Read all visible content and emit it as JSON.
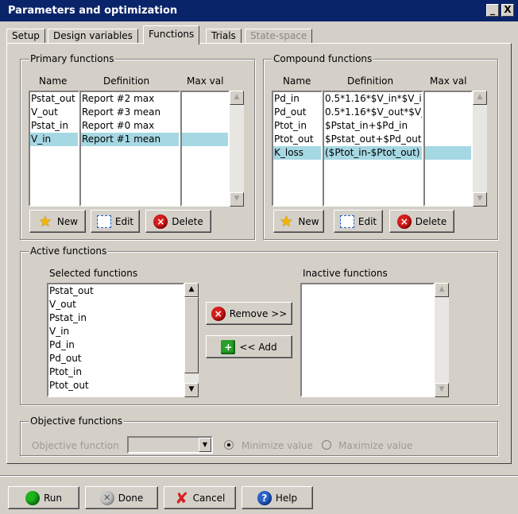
{
  "window": {
    "title": "Parameters and optimization",
    "minimize_glyph": "_",
    "close_glyph": "X"
  },
  "tabs": [
    {
      "label": "Setup",
      "state": "normal"
    },
    {
      "label": "Design variables",
      "state": "normal"
    },
    {
      "label": "Functions",
      "state": "active"
    },
    {
      "label": "Trials",
      "state": "normal"
    },
    {
      "label": "State-space",
      "state": "disabled"
    }
  ],
  "primary": {
    "title": "Primary functions",
    "headers": {
      "name": "Name",
      "definition": "Definition",
      "max": "Max val"
    },
    "names": [
      "Pstat_out",
      "V_out",
      "Pstat_in",
      "V_in"
    ],
    "definitions": [
      "Report #2 max",
      "Report #3 mean",
      "Report #0 max",
      "Report #1 mean"
    ],
    "maxvals": [
      "",
      "",
      "",
      ""
    ],
    "selected_row": 3,
    "buttons": {
      "new": "New",
      "edit": "Edit",
      "delete": "Delete"
    }
  },
  "compound": {
    "title": "Compound functions",
    "headers": {
      "name": "Name",
      "definition": "Definition",
      "max": "Max val"
    },
    "names": [
      "Pd_in",
      "Pd_out",
      "Ptot_in",
      "Ptot_out",
      "K_loss"
    ],
    "definitions": [
      "0.5*1.16*$V_in*$V_i",
      "0.5*1.16*$V_out*$V_",
      "$Pstat_in+$Pd_in",
      "$Pstat_out+$Pd_out",
      "($Ptot_in-$Ptot_out)"
    ],
    "maxvals": [
      "",
      "",
      "",
      "",
      ""
    ],
    "selected_row": 4,
    "buttons": {
      "new": "New",
      "edit": "Edit",
      "delete": "Delete"
    }
  },
  "active": {
    "title": "Active functions",
    "selected_label": "Selected functions",
    "inactive_label": "Inactive functions",
    "selected_items": [
      "Pstat_out",
      "V_out",
      "Pstat_in",
      "V_in",
      "Pd_in",
      "Pd_out",
      "Ptot_in",
      "Ptot_out"
    ],
    "inactive_items": [],
    "remove_label": "Remove >>",
    "add_label": "<< Add"
  },
  "objective": {
    "title": "Objective functions",
    "field_label": "Objective function",
    "field_value": "",
    "minimize_label": "Minimize value",
    "maximize_label": "Maximize value",
    "minimize_checked": true
  },
  "footer": {
    "run": "Run",
    "done": "Done",
    "cancel": "Cancel",
    "help": "Help"
  },
  "colors": {
    "titlebar": "#0a246a",
    "selection": "#a6d8e3",
    "face": "#d4d0c8"
  }
}
